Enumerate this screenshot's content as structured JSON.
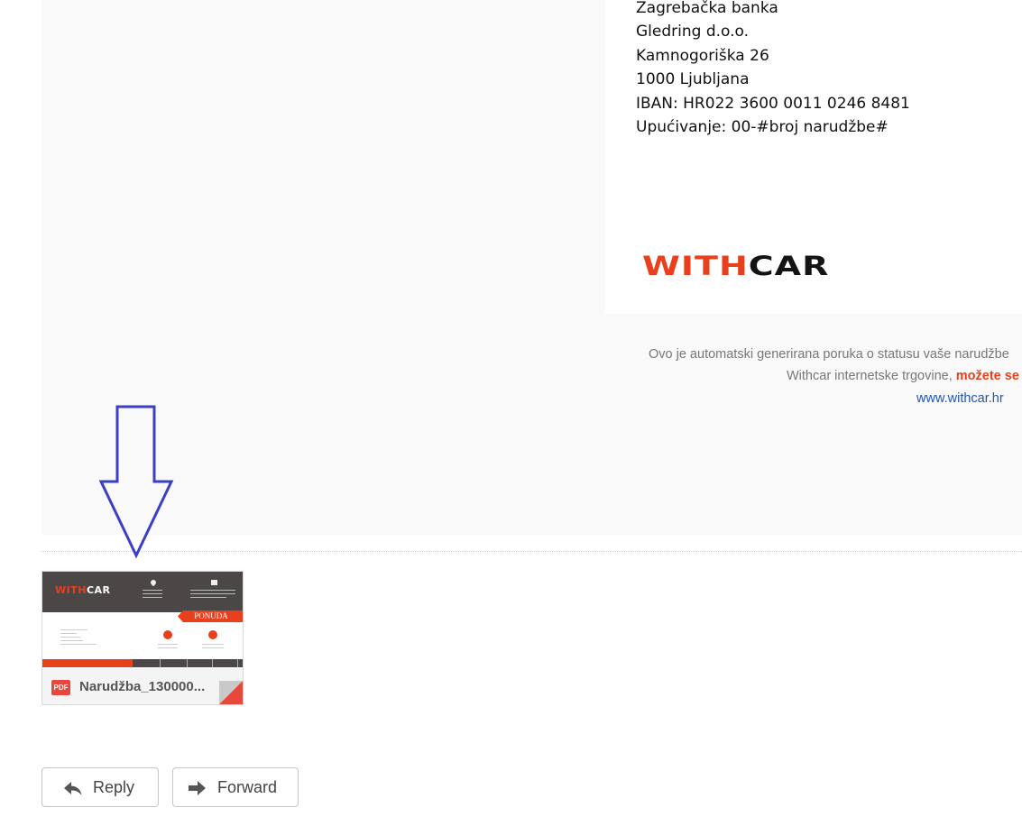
{
  "bank_details": {
    "lines": [
      "Zagrebačka banka",
      "Gledring d.o.o.",
      "Kamnogoriška 26",
      "1000 Ljubljana",
      "IBAN: HR022 3600 0011 0246 8481",
      "Upućivanje: 00-#broj narudžbe#"
    ]
  },
  "logo": {
    "part1": "WITH",
    "part2": "CAR",
    "color_accent": "#e8401c",
    "color_dark": "#141414"
  },
  "footer": {
    "line1": "Ovo je automatski generirana poruka o statusu vaše narudžbe",
    "line2_prefix": "Withcar internetske trgovine, ",
    "line2_bold": "možete se",
    "link": "www.withcar.hr"
  },
  "attachment": {
    "filename": "Narudžba_130000...",
    "type_badge": "PDF",
    "thumbnail": {
      "logo_part1": "WITH",
      "logo_part2": "CAR",
      "ribbon_label": "PONUDA"
    }
  },
  "actions": {
    "reply_label": "Reply",
    "forward_label": "Forward"
  },
  "colors": {
    "annotation_arrow": "#3b3fc4",
    "link": "#2155b5"
  }
}
